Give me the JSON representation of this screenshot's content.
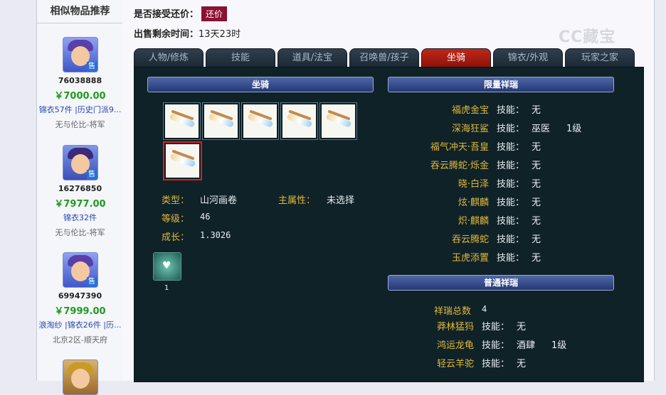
{
  "sidebar": {
    "title": "相似物品推荐",
    "items": [
      {
        "id": "76038888",
        "price": "￥7000.00",
        "tags": "锦衣57件 |历史门派9...",
        "server": "无与伦比-将军",
        "badge": "售"
      },
      {
        "id": "16276850",
        "price": "￥7977.00",
        "tags": "锦衣32件",
        "server": "无与伦比-将军",
        "badge": "售"
      },
      {
        "id": "69947390",
        "price": "￥7999.00",
        "tags": "浪淘纱 |锦衣26件 |历...",
        "server": "北京2区-顺天府",
        "badge": "售"
      }
    ]
  },
  "header": {
    "haggle_label": "是否接受还价：",
    "haggle_value": "还价",
    "time_label": "出售剩余时间：",
    "time_value": "13天23时",
    "watermark": "CC藏宝"
  },
  "tabs": [
    {
      "label": "人物/修炼",
      "active": false
    },
    {
      "label": "技能",
      "active": false
    },
    {
      "label": "道具/法宝",
      "active": false
    },
    {
      "label": "召唤兽/孩子",
      "active": false
    },
    {
      "label": "坐骑",
      "active": true
    },
    {
      "label": "锦衣/外观",
      "active": false
    },
    {
      "label": "玩家之家",
      "active": false
    }
  ],
  "mount": {
    "section_title": "坐骑",
    "slot_count": 6,
    "type_label": "类型：",
    "type_value": "山河画卷",
    "main_attr_label": "主属性：",
    "main_attr_value": "未选择",
    "level_label": "等级：",
    "level_value": "46",
    "growth_label": "成长：",
    "growth_value": "1.3026",
    "skill_count": "1"
  },
  "limited": {
    "title": "限量祥瑞",
    "skill_label": "技能：",
    "rows": [
      {
        "name": "福虎金宝",
        "skill": "无",
        "level": ""
      },
      {
        "name": "深海狂鲨",
        "skill": "巫医",
        "level": "1级"
      },
      {
        "name": "福气冲天·吾皇",
        "skill": "无",
        "level": ""
      },
      {
        "name": "吞云腾蛇·烁金",
        "skill": "无",
        "level": ""
      },
      {
        "name": "晓·白泽",
        "skill": "无",
        "level": ""
      },
      {
        "name": "炫·麒麟",
        "skill": "无",
        "level": ""
      },
      {
        "name": "炽·麒麟",
        "skill": "无",
        "level": ""
      },
      {
        "name": "吞云腾蛇",
        "skill": "无",
        "level": ""
      },
      {
        "name": "玉虎添置",
        "skill": "无",
        "level": ""
      }
    ]
  },
  "normal": {
    "title": "普通祥瑞",
    "total_label": "祥瑞总数",
    "total_value": "4",
    "skill_label": "技能：",
    "rows": [
      {
        "name": "莽林猛犸",
        "skill": "无",
        "level": ""
      },
      {
        "name": "鸿运龙龟",
        "skill": "酒肆",
        "level": "1级"
      },
      {
        "name": "轻云羊驼",
        "skill": "无",
        "level": ""
      }
    ]
  },
  "colors": {
    "accent_red": "#8c1030",
    "panel_bg": "#0f2228",
    "gold_text": "#e0b83a",
    "price_green": "#1e9a1e"
  }
}
